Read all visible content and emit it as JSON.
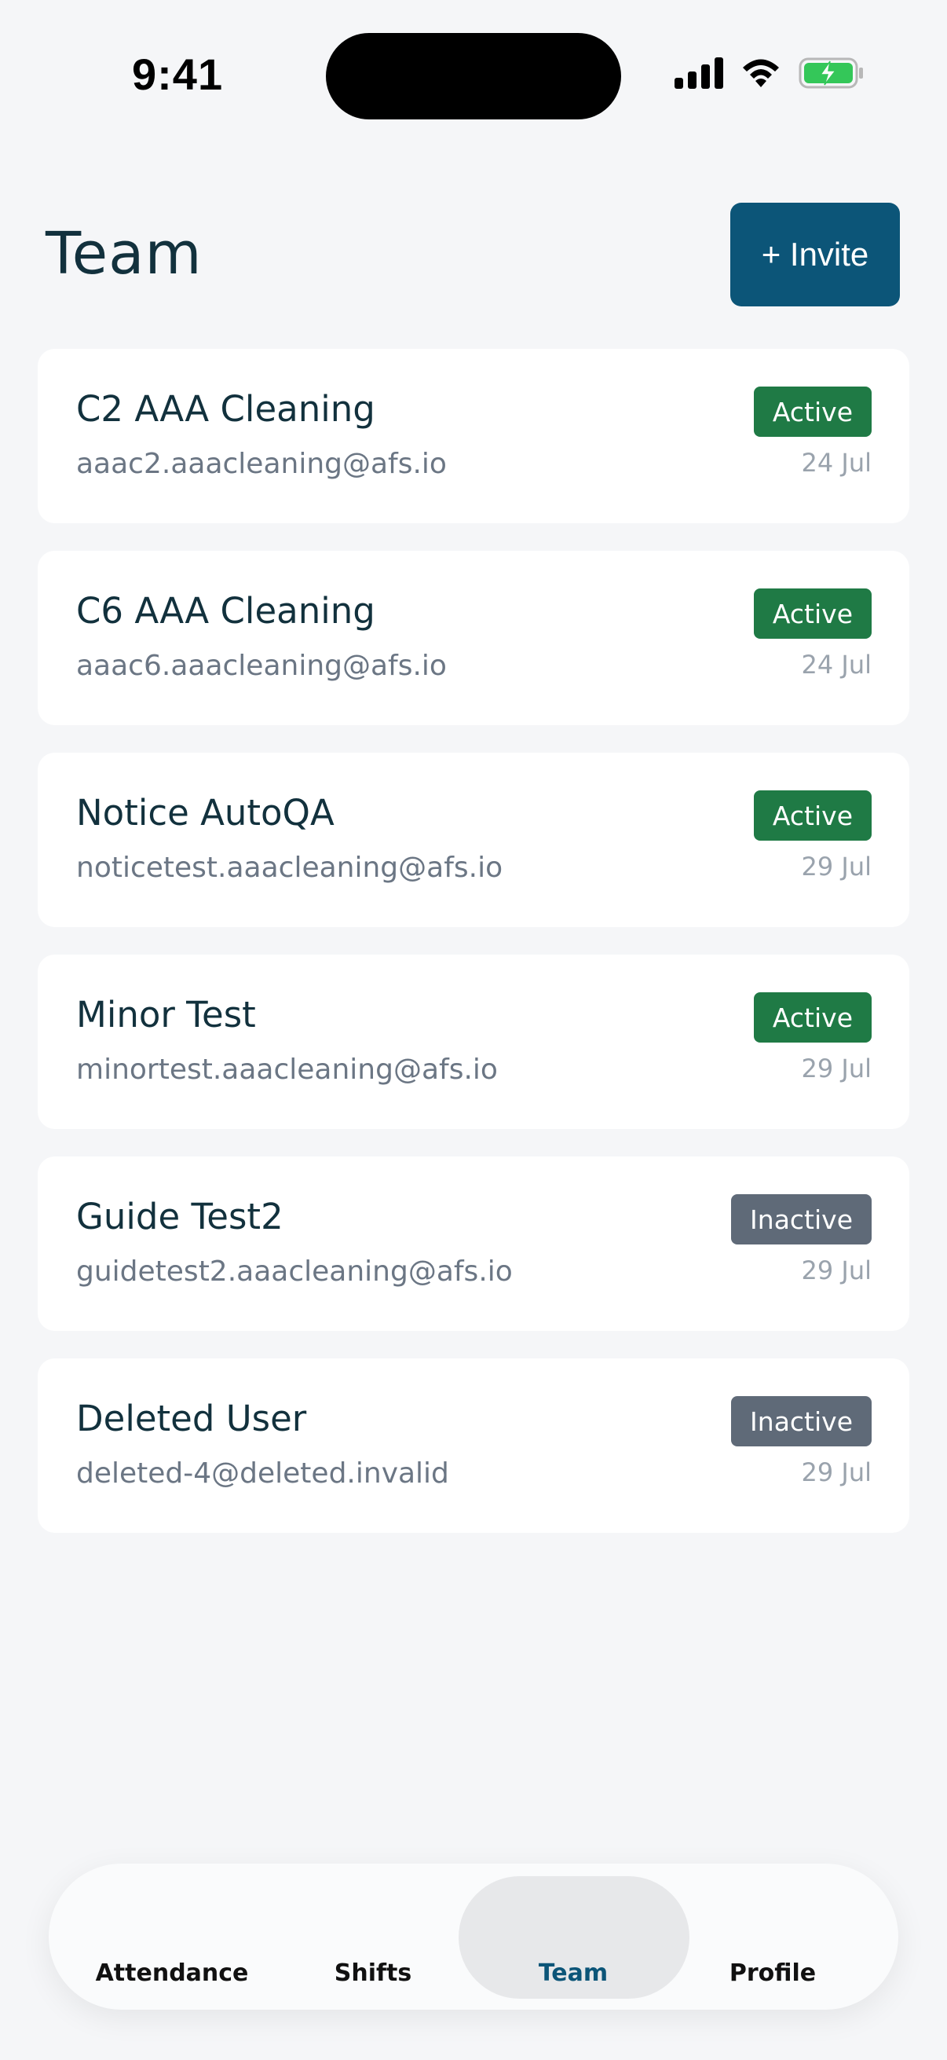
{
  "status_bar": {
    "time": "9:41"
  },
  "header": {
    "title": "Team",
    "invite_label": "+ Invite"
  },
  "members": [
    {
      "name": "C2 AAA Cleaning",
      "email": "aaac2.aaacleaning@afs.io",
      "status": "Active",
      "date": "24 Jul"
    },
    {
      "name": "C6 AAA Cleaning",
      "email": "aaac6.aaacleaning@afs.io",
      "status": "Active",
      "date": "24 Jul"
    },
    {
      "name": "Notice AutoQA",
      "email": "noticetest.aaacleaning@afs.io",
      "status": "Active",
      "date": "29 Jul"
    },
    {
      "name": "Minor Test",
      "email": "minortest.aaacleaning@afs.io",
      "status": "Active",
      "date": "29 Jul"
    },
    {
      "name": "Guide Test2",
      "email": "guidetest2.aaacleaning@afs.io",
      "status": "Inactive",
      "date": "29 Jul"
    },
    {
      "name": "Deleted User",
      "email": "deleted-4@deleted.invalid",
      "status": "Inactive",
      "date": "29 Jul"
    }
  ],
  "nav": {
    "items": [
      {
        "label": "Attendance"
      },
      {
        "label": "Shifts"
      },
      {
        "label": "Team"
      },
      {
        "label": "Profile"
      }
    ],
    "selected": "Team"
  },
  "colors": {
    "primary": "#0c5578",
    "active_badge": "#1f7a45",
    "inactive_badge": "#5f6a78",
    "background": "#f5f6f8",
    "battery_charging": "#34c759"
  },
  "icons": [
    "signal-icon",
    "wifi-icon",
    "battery-charging-icon"
  ]
}
